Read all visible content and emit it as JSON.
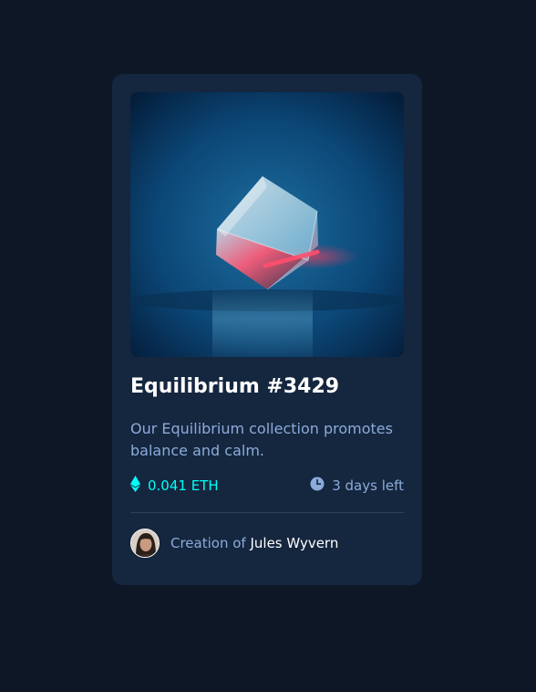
{
  "card": {
    "title": "Equilibrium #3429",
    "description": "Our Equilibrium collection promotes balance and calm.",
    "price": "0.041 ETH",
    "time_left": "3 days left",
    "creator_prefix": "Creation of ",
    "creator_name": "Jules Wyvern"
  },
  "icons": {
    "price": "ethereum-icon",
    "time": "clock-icon"
  },
  "colors": {
    "page_background": "#0e1726",
    "card_background": "#15263f",
    "heading": "#ffffff",
    "soft_blue": "#8bacd9",
    "cyan": "#00fff8",
    "divider": "#2e405a"
  }
}
